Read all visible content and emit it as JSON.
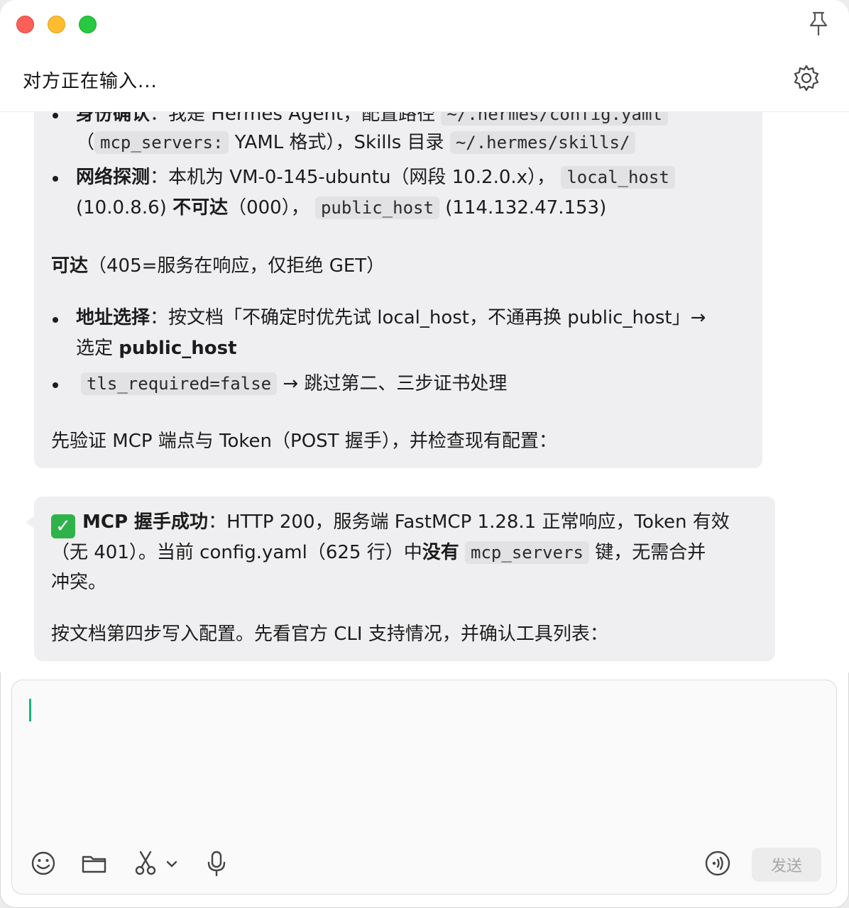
{
  "window": {
    "title": "对方正在输入..."
  },
  "message1": {
    "l0_label": "身份确认",
    "l0_rest": "：我是 Hermes Agent，配置路径",
    "l0_code": "~/.hermes/config.yaml",
    "l1_open": "（",
    "l1_code1": "mcp_servers:",
    "l1_mid": " YAML 格式），Skills 目录 ",
    "l1_code2": "~/.hermes/skills/",
    "l2_label": "网络探测",
    "l2_rest": "：本机为 VM-0-145-ubuntu（网段 10.2.0.x），",
    "l2_code": "local_host",
    "l3_a": "(10.0.8.6) ",
    "l3_bold": "不可达",
    "l3_b": "（000），",
    "l3_code": "public_host",
    "l3_c": " (114.132.47.153)",
    "l4_bold": "可达",
    "l4_rest": "（405=服务在响应，仅拒绝 GET）",
    "l5_label": "地址选择",
    "l5_rest": "：按文档「不确定时优先试 local_host，不通再换 public_host」→",
    "l6_a": "选定 ",
    "l6_bold": "public_host",
    "l7_code": "tls_required=false",
    "l7_rest": " → 跳过第二、三步证书处理",
    "l8": "先验证 MCP 端点与 Token（POST 握手），并检查现有配置："
  },
  "message2": {
    "check": "✓",
    "l0_bold": "MCP 握手成功",
    "l0_rest": "：HTTP 200，服务端 FastMCP 1.28.1 正常响应，Token 有效",
    "l1_a": "（无 401）。当前 config.yaml（625 行）中",
    "l1_bold": "没有",
    "l1_code": "mcp_servers",
    "l1_b": " 键，无需合并",
    "l2": "冲突。",
    "l3": "按文档第四步写入配置。先看官方 CLI 支持情况，并确认工具列表："
  },
  "composer": {
    "send_label": "发送"
  },
  "icons": [
    "pin-icon",
    "gear-icon",
    "emoji-icon",
    "folder-icon",
    "scissors-icon",
    "chevron-down-icon",
    "microphone-icon",
    "voice-call-icon"
  ]
}
